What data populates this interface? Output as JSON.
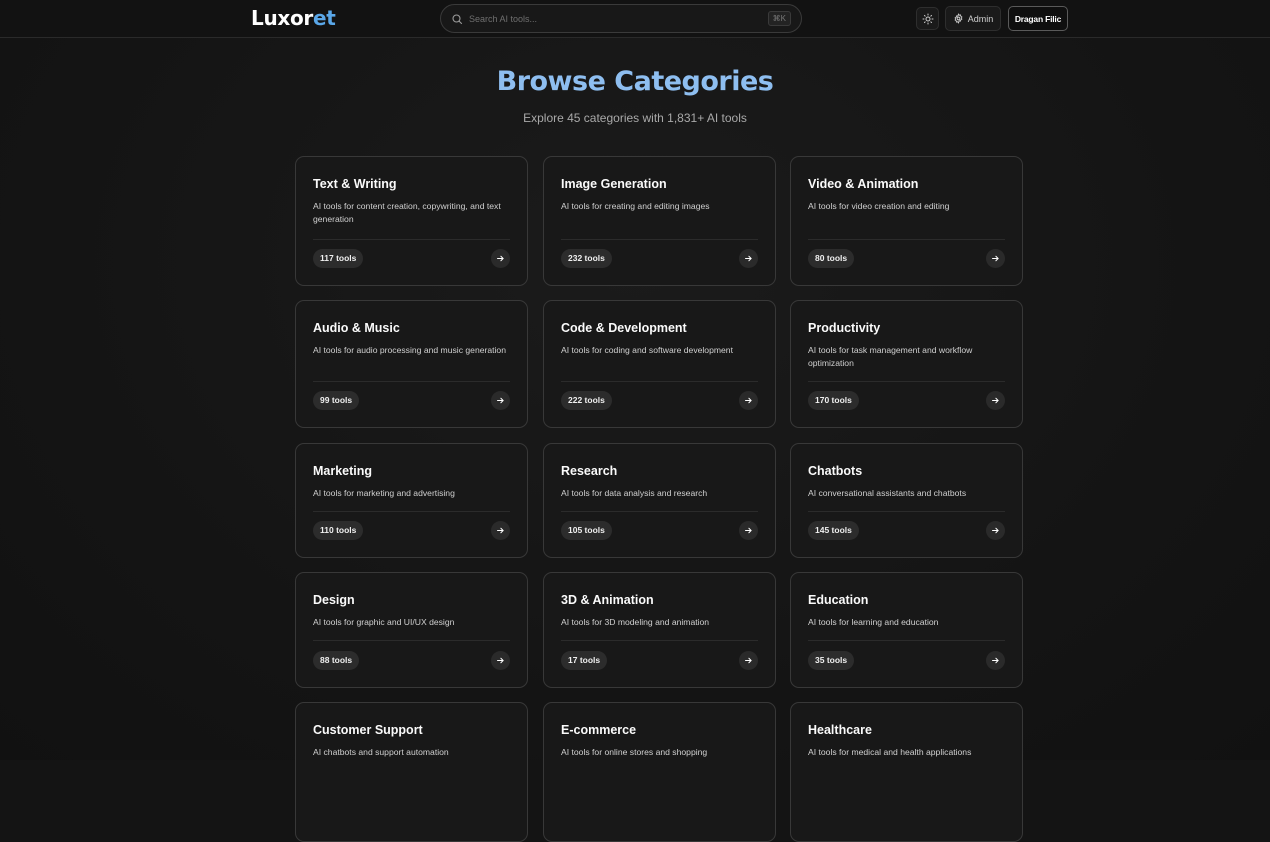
{
  "header": {
    "logo_part1": "Luxor",
    "logo_part2": "et",
    "search_placeholder": "Search AI tools...",
    "search_shortcut": "⌘K",
    "theme_icon": "sun-icon",
    "admin_label": "Admin",
    "user_name": "Dragan Filic"
  },
  "hero": {
    "title": "Browse Categories",
    "subtitle": "Explore 45 categories with 1,831+ AI tools"
  },
  "colors": {
    "accent": "#5aa7e8",
    "title": "#8ebef0",
    "background": "#141414",
    "card": "#181818"
  },
  "categories": [
    {
      "name": "Text & Writing",
      "description": "AI tools for content creation, copywriting, and text generation",
      "count": "117 tools"
    },
    {
      "name": "Image Generation",
      "description": "AI tools for creating and editing images",
      "count": "232 tools"
    },
    {
      "name": "Video & Animation",
      "description": "AI tools for video creation and editing",
      "count": "80 tools"
    },
    {
      "name": "Audio & Music",
      "description": "AI tools for audio processing and music generation",
      "count": "99 tools"
    },
    {
      "name": "Code & Development",
      "description": "AI tools for coding and software development",
      "count": "222 tools"
    },
    {
      "name": "Productivity",
      "description": "AI tools for task management and workflow optimization",
      "count": "170 tools"
    },
    {
      "name": "Marketing",
      "description": "AI tools for marketing and advertising",
      "count": "110 tools"
    },
    {
      "name": "Research",
      "description": "AI tools for data analysis and research",
      "count": "105 tools"
    },
    {
      "name": "Chatbots",
      "description": "AI conversational assistants and chatbots",
      "count": "145 tools"
    },
    {
      "name": "Design",
      "description": "AI tools for graphic and UI/UX design",
      "count": "88 tools"
    },
    {
      "name": "3D & Animation",
      "description": "AI tools for 3D modeling and animation",
      "count": "17 tools"
    },
    {
      "name": "Education",
      "description": "AI tools for learning and education",
      "count": "35 tools"
    },
    {
      "name": "Customer Support",
      "description": "AI chatbots and support automation",
      "count": ""
    },
    {
      "name": "E-commerce",
      "description": "AI tools for online stores and shopping",
      "count": ""
    },
    {
      "name": "Healthcare",
      "description": "AI tools for medical and health applications",
      "count": ""
    }
  ]
}
